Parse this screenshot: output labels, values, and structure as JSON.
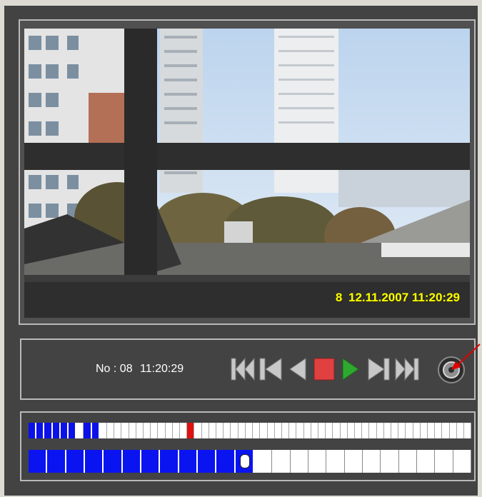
{
  "video": {
    "osd_channel": "8",
    "osd_datetime": "12.11.2007 11:20:29"
  },
  "controls": {
    "info_label": "No : 08",
    "info_time": "11:20:29",
    "buttons": [
      "fast-rewind-icon",
      "step-back-icon",
      "play-reverse-icon",
      "stop-icon",
      "play-icon",
      "step-forward-icon",
      "fast-forward-icon",
      "record-knob-icon"
    ],
    "colors": {
      "stop": "#e04040",
      "play": "#2fa82f",
      "icon_gray": "#c8c8c8"
    }
  },
  "timeline": {
    "row1_cells": 60,
    "row1_recorded": [
      0,
      1,
      2,
      3,
      4,
      5,
      7,
      8
    ],
    "row1_current": 21,
    "row2_cells": 24,
    "row2_recorded": [
      0,
      1,
      2,
      3,
      4,
      5,
      6,
      7,
      8,
      9,
      10,
      11
    ],
    "row2_current": 11,
    "colors": {
      "recorded": "#0b11e8",
      "current_marker": "#e01010",
      "empty": "#ffffff"
    }
  },
  "annotation": {
    "arrow_color": "#e00000"
  }
}
